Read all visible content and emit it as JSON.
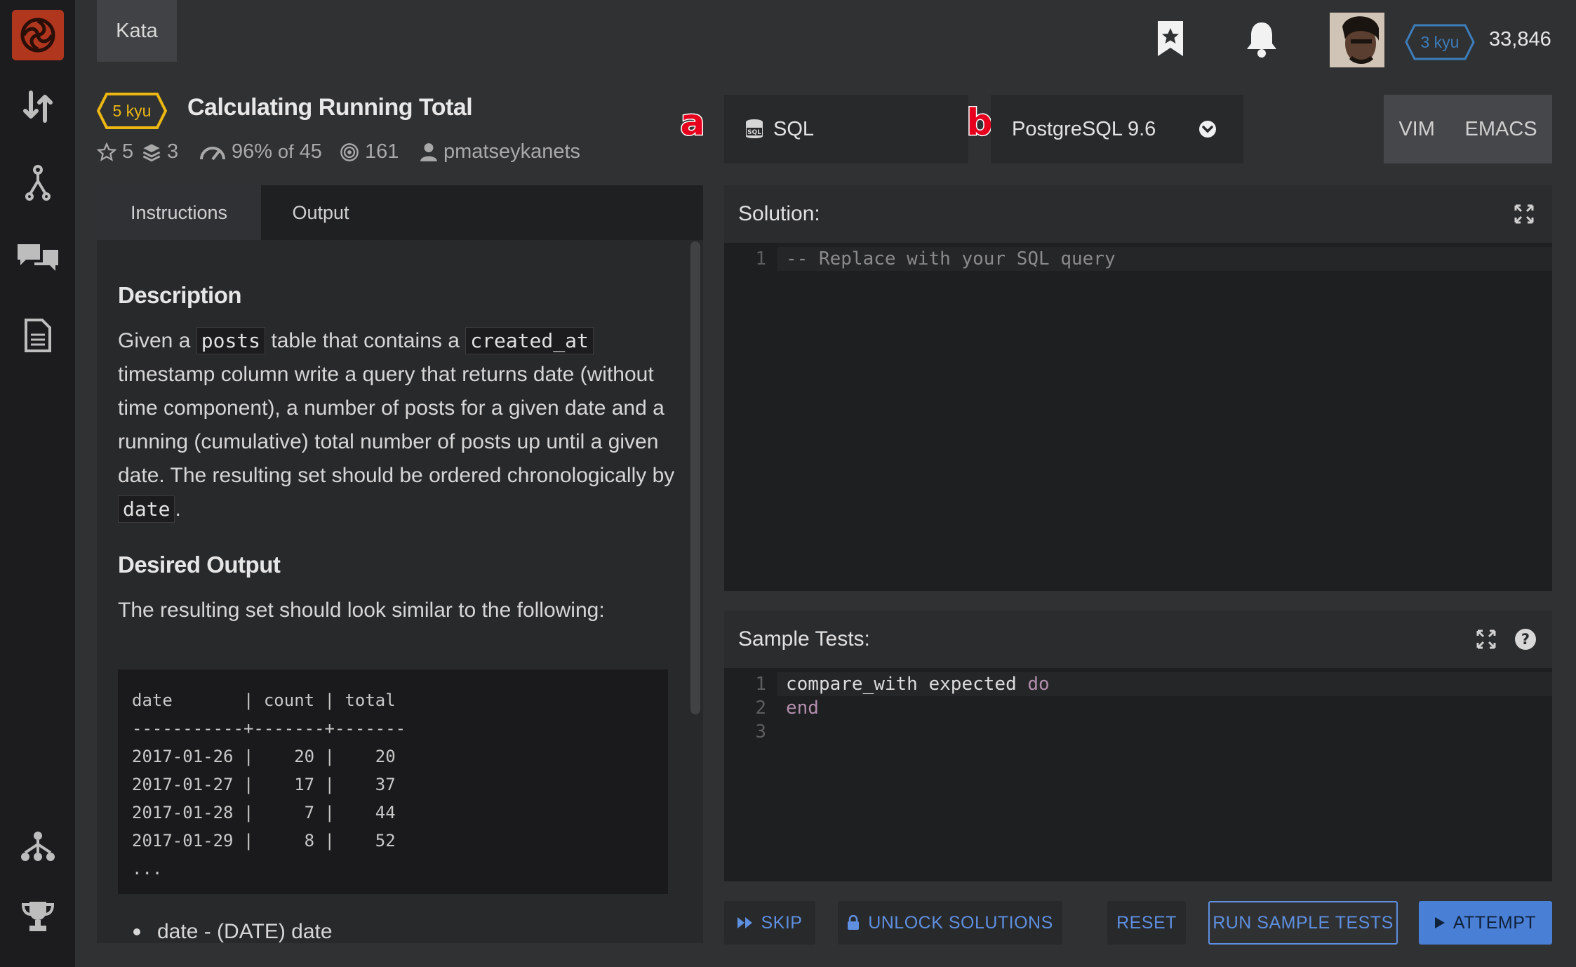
{
  "nav": {
    "kata_tab": "Kata"
  },
  "user": {
    "rank": "3 kyu",
    "honor": "33,846"
  },
  "kata": {
    "rank": "5 kyu",
    "title": "Calculating Running Total",
    "stars": "5",
    "collections": "3",
    "satisfaction_pct": "96%",
    "satisfaction_of": "of",
    "satisfaction_votes": "45",
    "completions": "161",
    "author": "pmatseykanets"
  },
  "markers": {
    "a": "a",
    "b": "b"
  },
  "language": {
    "name": "SQL",
    "version": "PostgreSQL 9.6"
  },
  "modes": {
    "vim": "VIM",
    "emacs": "EMACS"
  },
  "tabs": {
    "instructions": "Instructions",
    "output": "Output"
  },
  "description": {
    "heading": "Description",
    "p1_a": "Given a",
    "code_posts": "posts",
    "p1_b": "table that contains a",
    "code_created_at": "created_at",
    "p1_c": "timestamp column write a query that returns date (without time component), a number of posts for a given date and a running (cumulative) total number of posts up until a given date. The resulting set should be ordered chronologically by",
    "code_date": "date",
    "p1_end": ".",
    "heading2": "Desired Output",
    "p2": "The resulting set should look similar to the following:",
    "table_text": "date       | count | total\n-----------+-------+-------\n2017-01-26 |    20 |    20\n2017-01-27 |    17 |    37\n2017-01-28 |     7 |    44\n2017-01-29 |     8 |    52\n...",
    "bullet1": "date - (DATE) date"
  },
  "solution": {
    "label": "Solution:",
    "lines": [
      {
        "n": "1",
        "text": "-- Replace with your SQL query"
      }
    ]
  },
  "tests": {
    "label": "Sample Tests:",
    "line1_n": "1",
    "line1_a": "compare_with expected",
    "line1_kw": "do",
    "line2_n": "2",
    "line2_kw": "end",
    "line3_n": "3"
  },
  "buttons": {
    "skip": "SKIP",
    "unlock": "UNLOCK SOLUTIONS",
    "reset": "RESET",
    "run": "RUN SAMPLE TESTS",
    "attempt": "ATTEMPT"
  },
  "colors": {
    "brand": "#b1361e",
    "kyu_yellow": "#ecb613",
    "user_rank_blue": "#3c7ebb",
    "attempt_blue": "#4a7fd6",
    "sql_keyword": "#b48ead"
  }
}
